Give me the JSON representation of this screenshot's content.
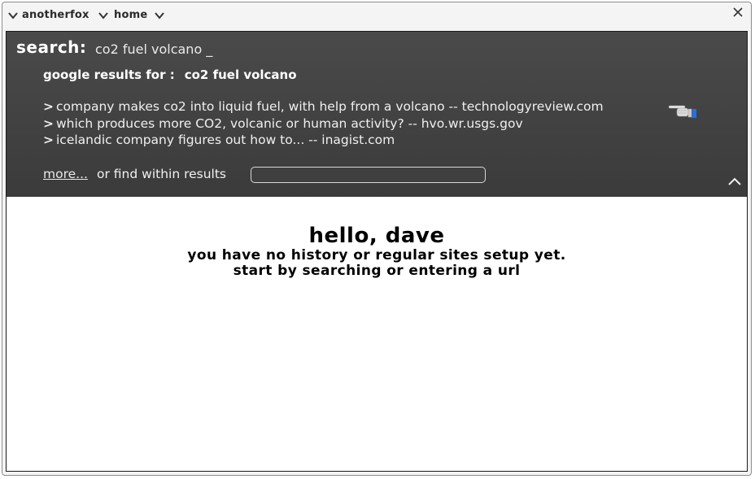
{
  "titlebar": {
    "app_name": "anotherfox",
    "location": "home",
    "icons": [
      "chevron-down-icon",
      "close-icon"
    ]
  },
  "search": {
    "label": "search:",
    "query_text": "co2 fuel volcano  _"
  },
  "results": {
    "heading_prefix": "google results for :",
    "heading_query": "co2 fuel volcano",
    "items": [
      {
        "bullet": ">",
        "text": "company makes co2 into liquid fuel, with help from a volcano -- technologyreview.com"
      },
      {
        "bullet": ">",
        "text": "which produces more CO2, volcanic or human activity? -- hvo.wr.usgs.gov"
      },
      {
        "bullet": ">",
        "text": "icelandic company figures out how to... -- inagist.com"
      }
    ],
    "more_label": "more...",
    "find_label": "or find within results",
    "find_value": ""
  },
  "welcome": {
    "greeting": "hello, dave",
    "line1": "you have no history or regular sites setup yet.",
    "line2": "start by searching or entering a url"
  },
  "colors": {
    "panel_bg": "#424242",
    "panel_text": "#f0f0f0",
    "window_border": "#8c8c8c"
  }
}
